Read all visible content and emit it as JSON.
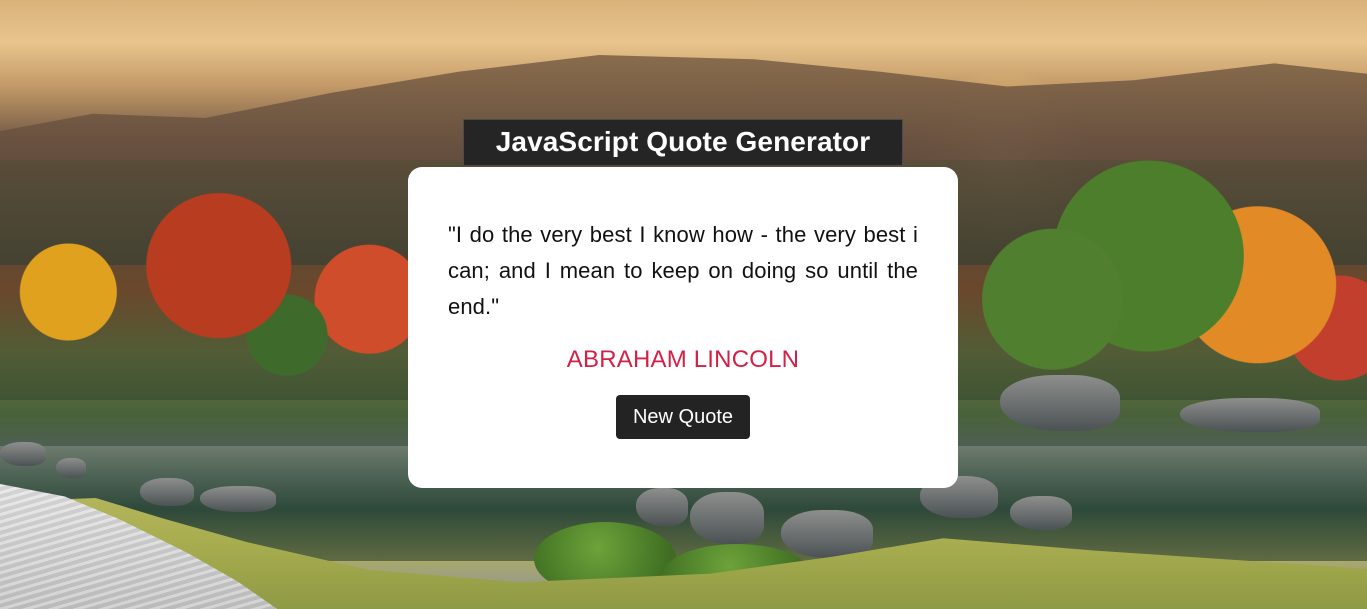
{
  "page": {
    "title": "JavaScript Quote Generator"
  },
  "quote": {
    "text": "\"I do the very best I know how - the very best i can; and I mean to keep on doing so until the end.\"",
    "author": "ABRAHAM LINCOLN"
  },
  "actions": {
    "new_quote_label": "New Quote"
  },
  "colors": {
    "title_background": "#252525",
    "card_background": "#ffffff",
    "quote_text": "#111111",
    "author_text": "#d51f45",
    "button_background": "#232323",
    "button_text": "#ffffff"
  }
}
